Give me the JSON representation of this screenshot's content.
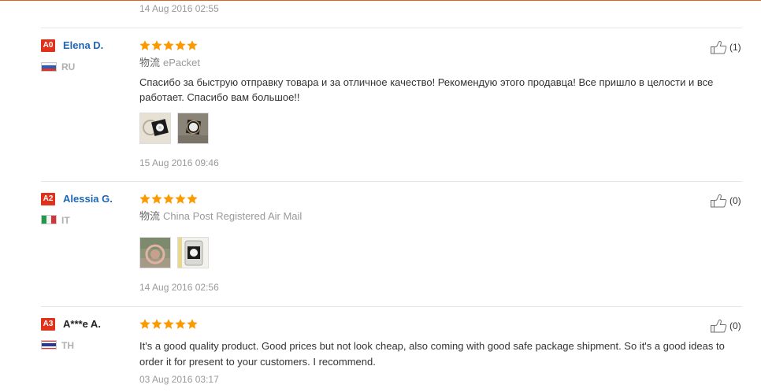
{
  "colors": {
    "star": "#fa9a00",
    "badge": "#e0311b",
    "link": "#1e66b8",
    "divider": "#e6e6e6",
    "top_border": "#e0602a"
  },
  "icons": {
    "like": "thumbs-up-icon",
    "rating": "star-icon"
  },
  "previous_review": {
    "date": "14 Aug 2016 02:55"
  },
  "reviews": [
    {
      "level_badge": "A0",
      "name": "Elena D.",
      "country": "RU",
      "rating": 5,
      "logistics_label": "物流",
      "logistics": "ePacket",
      "text_lines": [
        "Спасибо за быструю отправку товара и за отличное качество! Рекомендую этого продавца! Все пришло в целости и все",
        "работает. Спасибо вам большое!!"
      ],
      "helpful_count": "(1)",
      "date": "15 Aug 2016 09:46"
    },
    {
      "level_badge": "A2",
      "name": "Alessia G.",
      "country": "IT",
      "rating": 5,
      "logistics_label": "物流",
      "logistics": "China Post Registered Air Mail",
      "helpful_count": "(0)",
      "date": "14 Aug 2016 02:56"
    },
    {
      "level_badge": "A3",
      "name": "A***e A.",
      "country": "TH",
      "rating": 5,
      "text_lines": [
        "It's a good quality product. Good prices but not look cheap, also coming with good safe package shipment. So it's a good ideas to",
        "order it for present to your customers. I recommend."
      ],
      "helpful_count": "(0)",
      "date": "03 Aug 2016 03:17"
    }
  ]
}
